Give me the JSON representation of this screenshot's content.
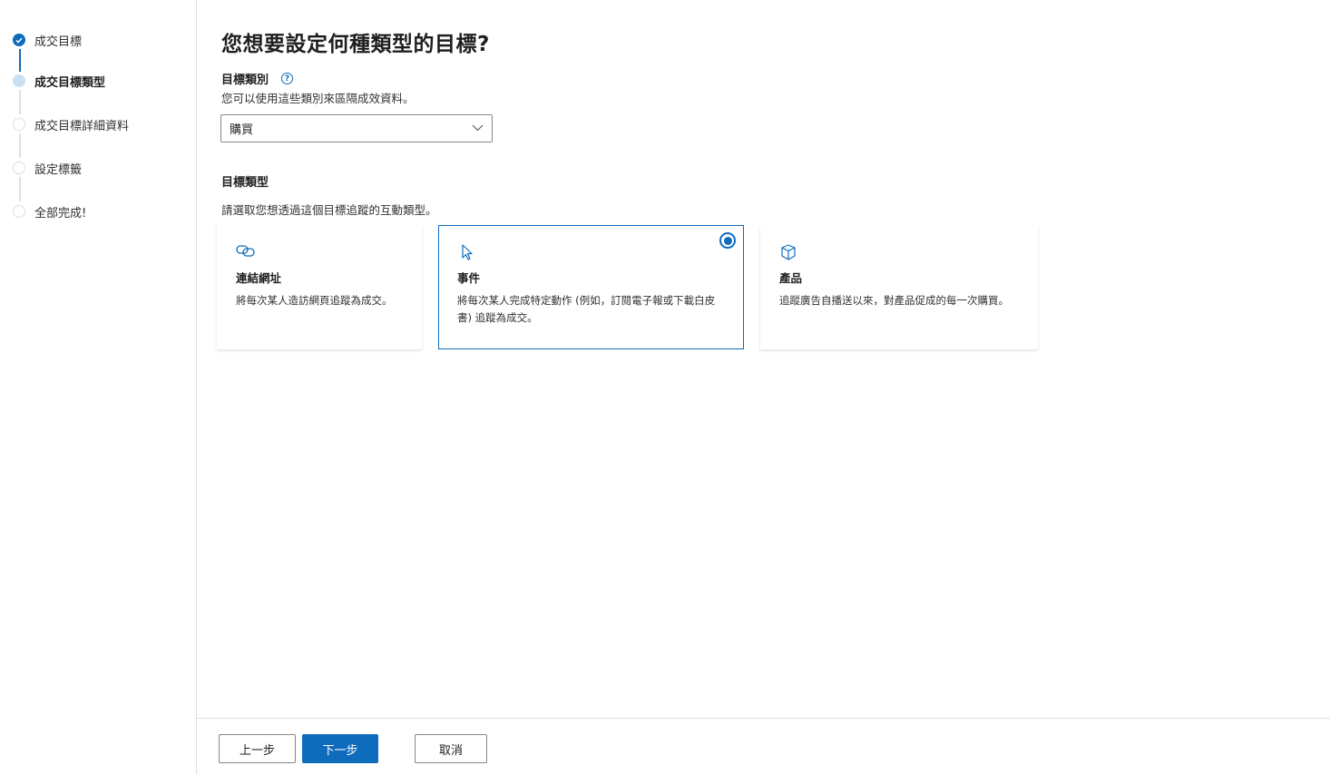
{
  "wizard": {
    "steps": [
      {
        "label": "成交目標",
        "state": "done"
      },
      {
        "label": "成交目標類型",
        "state": "current"
      },
      {
        "label": "成交目標詳細資料",
        "state": "pending"
      },
      {
        "label": "設定標籤",
        "state": "pending"
      },
      {
        "label": "全部完成!",
        "state": "pending"
      }
    ]
  },
  "main": {
    "title": "您想要設定何種類型的目標?",
    "category": {
      "label": "目標類別",
      "help_icon": "question-circle-icon",
      "description": "您可以使用這些類別來區隔成效資料。",
      "selected_value": "購買"
    },
    "goal_type": {
      "label": "目標類型",
      "description": "請選取您想透過這個目標追蹤的互動類型。",
      "options": [
        {
          "icon": "link-icon",
          "title": "連結網址",
          "description": "將每次某人造訪網頁追蹤為成交。",
          "selected": false
        },
        {
          "icon": "cursor-icon",
          "title": "事件",
          "description": "將每次某人完成特定動作 (例如，訂閱電子報或下載白皮書) 追蹤為成交。",
          "selected": true
        },
        {
          "icon": "box-icon",
          "title": "產品",
          "description": "追蹤廣告自播送以來，對產品促成的每一次購買。",
          "selected": false
        }
      ]
    }
  },
  "footer": {
    "back_label": "上一步",
    "next_label": "下一步",
    "cancel_label": "取消"
  },
  "colors": {
    "accent": "#0f6cbd",
    "current_step": "#c7e0f4",
    "border": "#e1dfdd"
  }
}
